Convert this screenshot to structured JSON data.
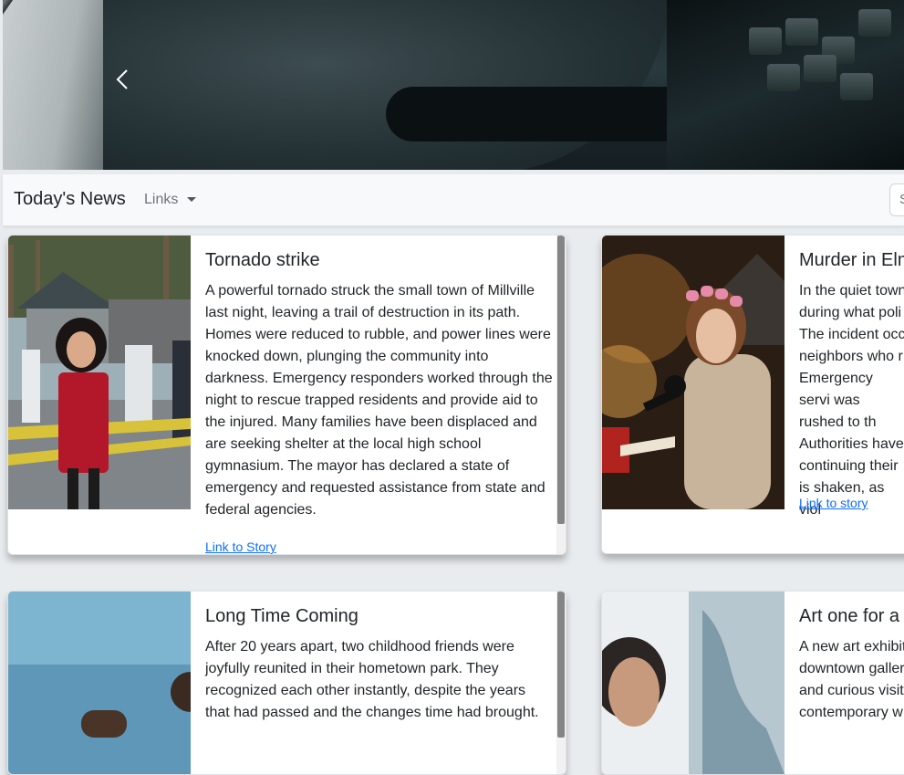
{
  "hero": {
    "prev_label": "Previous slide"
  },
  "navbar": {
    "brand": "Today's News",
    "links_label": "Links",
    "search_placeholder": "Search"
  },
  "cards": [
    {
      "title": "Tornado strike",
      "text": "A powerful tornado struck the small town of Millville last night, leaving a trail of destruction in its path. Homes were reduced to rubble, and power lines were knocked down, plunging the community into darkness. Emergency responders worked through the night to rescue trapped residents and provide aid to the injured. Many families have been displaced and are seeking shelter at the local high school gymnasium. The mayor has declared a state of emergency and requested assistance from state and federal agencies.",
      "link": "Link to Story"
    },
    {
      "title": "Murder in Elm",
      "text": "In the quiet town during what poli The incident occ neighbors who r Emergency servi was rushed to th Authorities have continuing their is shaken, as viol",
      "link": "Link to story"
    },
    {
      "title": "Long Time Coming",
      "text": "After 20 years apart, two childhood friends were joyfully reunited in their hometown park. They recognized each other instantly, despite the years that had passed and the changes time had brought.",
      "link": ""
    },
    {
      "title": "Art one for a",
      "text": "A new art exhibit downtown galler and curious visit contemporary w",
      "link": ""
    }
  ]
}
